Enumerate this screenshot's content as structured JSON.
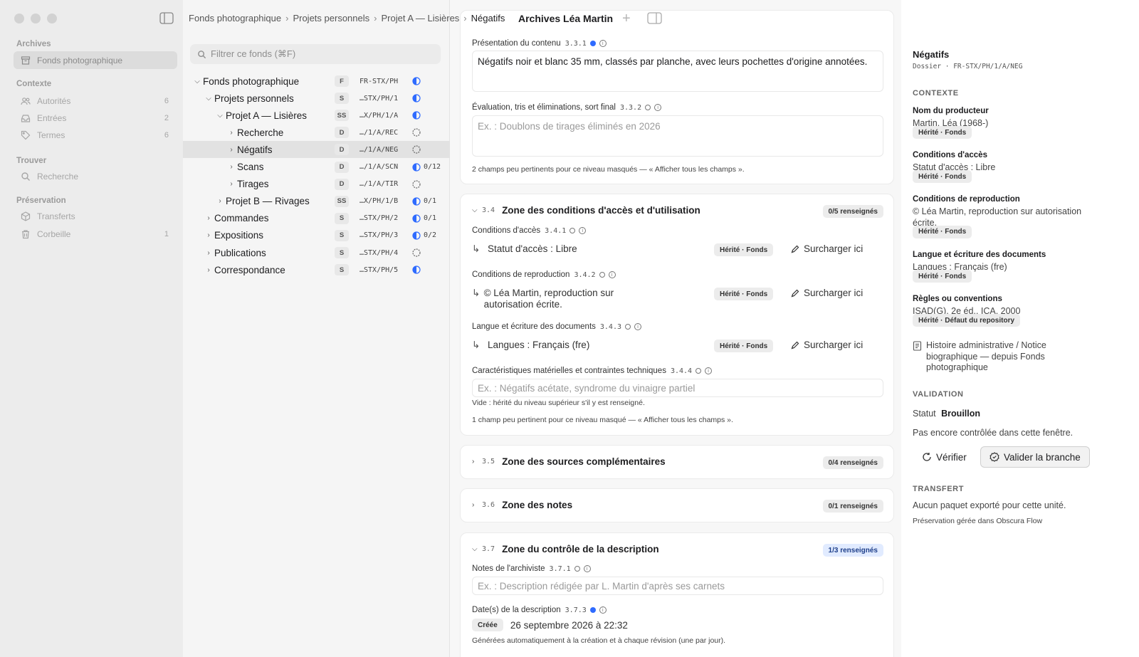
{
  "sidebar": {
    "sections": [
      {
        "title": "Archives",
        "items": [
          {
            "label": "Fonds photographique",
            "count": "",
            "icon": "archive-box-icon",
            "selected": true
          }
        ]
      },
      {
        "title": "Contexte",
        "items": [
          {
            "label": "Autorités",
            "count": "6",
            "icon": "people-icon"
          },
          {
            "label": "Entrées",
            "count": "2",
            "icon": "inbox-tray-icon"
          },
          {
            "label": "Termes",
            "count": "6",
            "icon": "tag-icon"
          }
        ]
      },
      {
        "title": "Trouver",
        "items": [
          {
            "label": "Recherche",
            "count": "",
            "icon": "search-icon"
          }
        ]
      },
      {
        "title": "Préservation",
        "items": [
          {
            "label": "Transferts",
            "count": "",
            "icon": "package-icon"
          },
          {
            "label": "Corbeille",
            "count": "1",
            "icon": "trash-icon"
          }
        ]
      }
    ]
  },
  "breadcrumb": [
    "Fonds photographique",
    "Projets personnels",
    "Projet A — Lisières",
    "Négatifs"
  ],
  "window_title": "Archives Léa Martin",
  "filter": {
    "placeholder": "Filtrer ce fonds (⌘F)"
  },
  "tree": [
    {
      "label": "Fonds photographique",
      "level": "F",
      "ref": "FR-STX/PH",
      "progress": "",
      "fill": 0.5,
      "depth": 0,
      "expanded": true
    },
    {
      "label": "Projets personnels",
      "level": "S",
      "ref": "…STX/PH/1",
      "progress": "",
      "fill": 0.5,
      "depth": 1,
      "expanded": true
    },
    {
      "label": "Projet A — Lisières",
      "level": "SS",
      "ref": "…X/PH/1/A",
      "progress": "",
      "fill": 0.5,
      "depth": 2,
      "expanded": true
    },
    {
      "label": "Recherche",
      "level": "D",
      "ref": "…/1/A/REC",
      "progress": "",
      "fill": 0,
      "depth": 3,
      "expanded": false
    },
    {
      "label": "Négatifs",
      "level": "D",
      "ref": "…/1/A/NEG",
      "progress": "",
      "fill": 0,
      "depth": 3,
      "expanded": false,
      "selected": true
    },
    {
      "label": "Scans",
      "level": "D",
      "ref": "…/1/A/SCN",
      "progress": "0/12",
      "fill": 0.5,
      "depth": 3,
      "expanded": false
    },
    {
      "label": "Tirages",
      "level": "D",
      "ref": "…/1/A/TIR",
      "progress": "",
      "fill": 0,
      "depth": 3,
      "expanded": false
    },
    {
      "label": "Projet B — Rivages",
      "level": "SS",
      "ref": "…X/PH/1/B",
      "progress": "0/1",
      "fill": 0.5,
      "depth": 2,
      "expanded": false
    },
    {
      "label": "Commandes",
      "level": "S",
      "ref": "…STX/PH/2",
      "progress": "0/1",
      "fill": 0.5,
      "depth": 1,
      "expanded": false
    },
    {
      "label": "Expositions",
      "level": "S",
      "ref": "…STX/PH/3",
      "progress": "0/2",
      "fill": 0.5,
      "depth": 1,
      "expanded": false
    },
    {
      "label": "Publications",
      "level": "S",
      "ref": "…STX/PH/4",
      "progress": "",
      "fill": 0,
      "depth": 1,
      "expanded": false
    },
    {
      "label": "Correspondance",
      "level": "S",
      "ref": "…STX/PH/5",
      "progress": "",
      "fill": 0.5,
      "depth": 1,
      "expanded": false
    }
  ],
  "content": {
    "card1": {
      "presentation": {
        "label": "Présentation du contenu",
        "code": "3.3.1",
        "value": "Négatifs noir et blanc 35 mm, classés par planche, avec leurs pochettes d'origine annotées."
      },
      "evaluation": {
        "label": "Évaluation, tris et éliminations, sort final",
        "code": "3.3.2",
        "placeholder": "Ex. : Doublons de tirages éliminés en 2026"
      },
      "note": "2 champs peu pertinents pour ce niveau masqués — « Afficher tous les champs »."
    },
    "zone34": {
      "code": "3.4",
      "title": "Zone des conditions d'accès et d'utilisation",
      "badge": "0/5 renseignés",
      "fields": [
        {
          "label": "Conditions d'accès",
          "code": "3.4.1",
          "value": "Statut d'accès : Libre",
          "tag": "Hérité · Fonds"
        },
        {
          "label": "Conditions de reproduction",
          "code": "3.4.2",
          "value": "© Léa Martin, reproduction sur autorisation écrite.",
          "tag": "Hérité · Fonds"
        },
        {
          "label": "Langue et écriture des documents",
          "code": "3.4.3",
          "value": "Langues : Français (fre)",
          "tag": "Hérité · Fonds"
        }
      ],
      "override_label": "Surcharger ici",
      "physical": {
        "label": "Caractéristiques matérielles et contraintes techniques",
        "code": "3.4.4",
        "placeholder": "Ex. : Négatifs acétate, syndrome du vinaigre partiel",
        "hint": "Vide : hérité du niveau supérieur s'il y est renseigné."
      },
      "note": "1 champ peu pertinent pour ce niveau masqué — « Afficher tous les champs »."
    },
    "zone35": {
      "code": "3.5",
      "title": "Zone des sources complémentaires",
      "badge": "0/4 renseignés"
    },
    "zone36": {
      "code": "3.6",
      "title": "Zone des notes",
      "badge": "0/1 renseignés"
    },
    "zone37": {
      "code": "3.7",
      "title": "Zone du contrôle de la description",
      "badge": "1/3 renseignés",
      "notes": {
        "label": "Notes de l'archiviste",
        "code": "3.7.1",
        "placeholder": "Ex. : Description rédigée par L. Martin d'après ses carnets"
      },
      "dates": {
        "label": "Date(s) de la description",
        "code": "3.7.3",
        "tag": "Créée",
        "value": "26 septembre 2026 à 22:32",
        "note": "Générées automatiquement à la création et à chaque révision (une par jour)."
      }
    }
  },
  "inspector": {
    "title": "Négatifs",
    "subtitle": "Dossier · FR-STX/PH/1/A/NEG",
    "contexte_title": "CONTEXTE",
    "items": [
      {
        "label": "Nom du producteur",
        "value": "Martin, Léa (1968-)",
        "tag": "Hérité · Fonds"
      },
      {
        "label": "Conditions d'accès",
        "value": "Statut d'accès : Libre",
        "tag": "Hérité · Fonds"
      },
      {
        "label": "Conditions de reproduction",
        "value": "© Léa Martin, reproduction sur autorisation écrite.",
        "tag": "Hérité · Fonds"
      },
      {
        "label": "Langue et écriture des documents",
        "value": "Langues : Français (fre)",
        "tag": "Hérité · Fonds"
      },
      {
        "label": "Règles ou conventions",
        "value": "ISAD(G), 2e éd., ICA, 2000",
        "tag": "Hérité · Défaut du repository"
      }
    ],
    "history_link": "Histoire administrative / Notice biographique — depuis Fonds photographique",
    "validation_title": "VALIDATION",
    "status_label": "Statut",
    "status_value": "Brouillon",
    "status_note": "Pas encore contrôlée dans cette fenêtre.",
    "verify_label": "Vérifier",
    "validate_label": "Valider la branche",
    "transfer_title": "TRANSFERT",
    "transfer_text": "Aucun paquet exporté pour cette unité.",
    "transfer_note": "Préservation gérée dans Obscura Flow"
  },
  "colors": {
    "accent": "#2f6bff",
    "sidebar_bg": "#ececec",
    "tree_bg": "#f5f5f5"
  }
}
